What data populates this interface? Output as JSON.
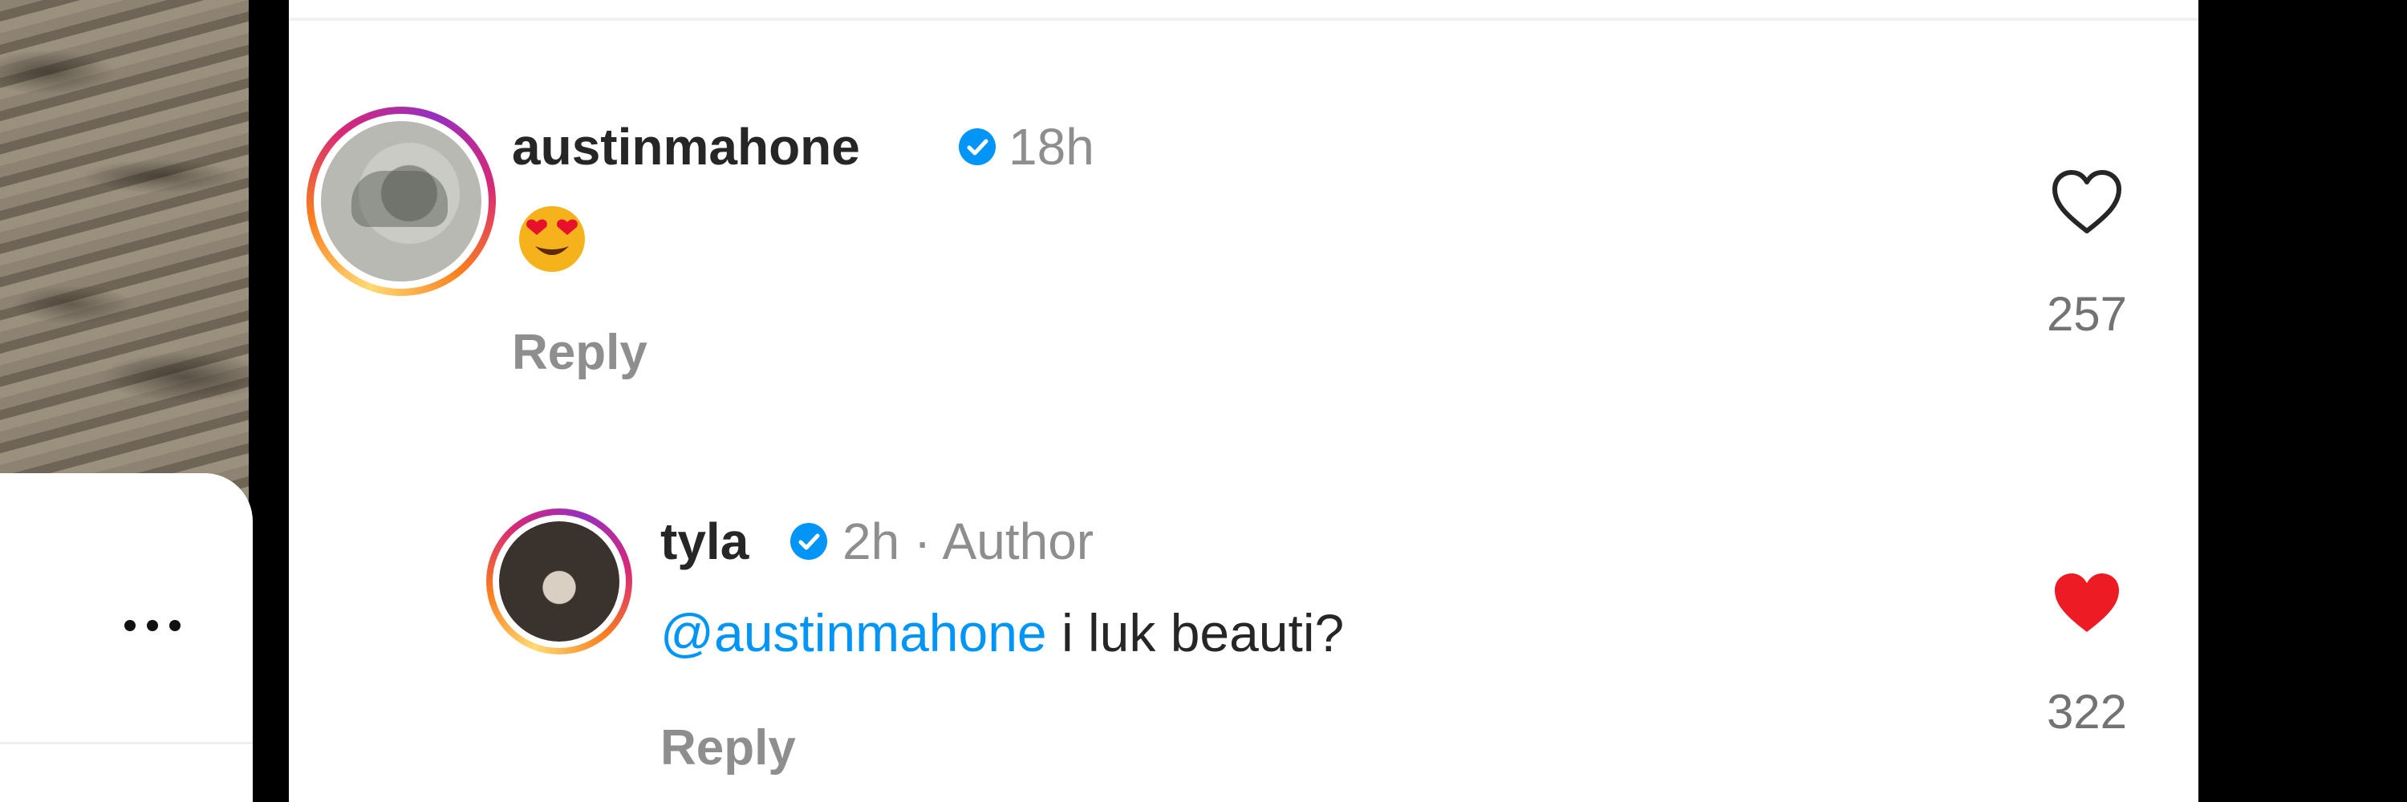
{
  "comments": [
    {
      "username": "austinmahone",
      "verified": true,
      "time": "18h",
      "text_emoji": "heart-eyes-emoji",
      "reply_label": "Reply",
      "likes": "257",
      "liked": false
    },
    {
      "username": "tyla",
      "verified": true,
      "time": "2h",
      "separator": "·",
      "author_badge": "Author",
      "mention": "@austinmahone",
      "text": "i luk beauti?",
      "reply_label": "Reply",
      "likes": "322",
      "liked": true
    }
  ],
  "left_card": {
    "menu_icon": "more-horizontal-icon"
  },
  "colors": {
    "verified": "#0095f6",
    "mention": "#0095f6",
    "liked_heart": "#ed1c24",
    "text": "#262626",
    "muted": "#8e8e8e"
  }
}
